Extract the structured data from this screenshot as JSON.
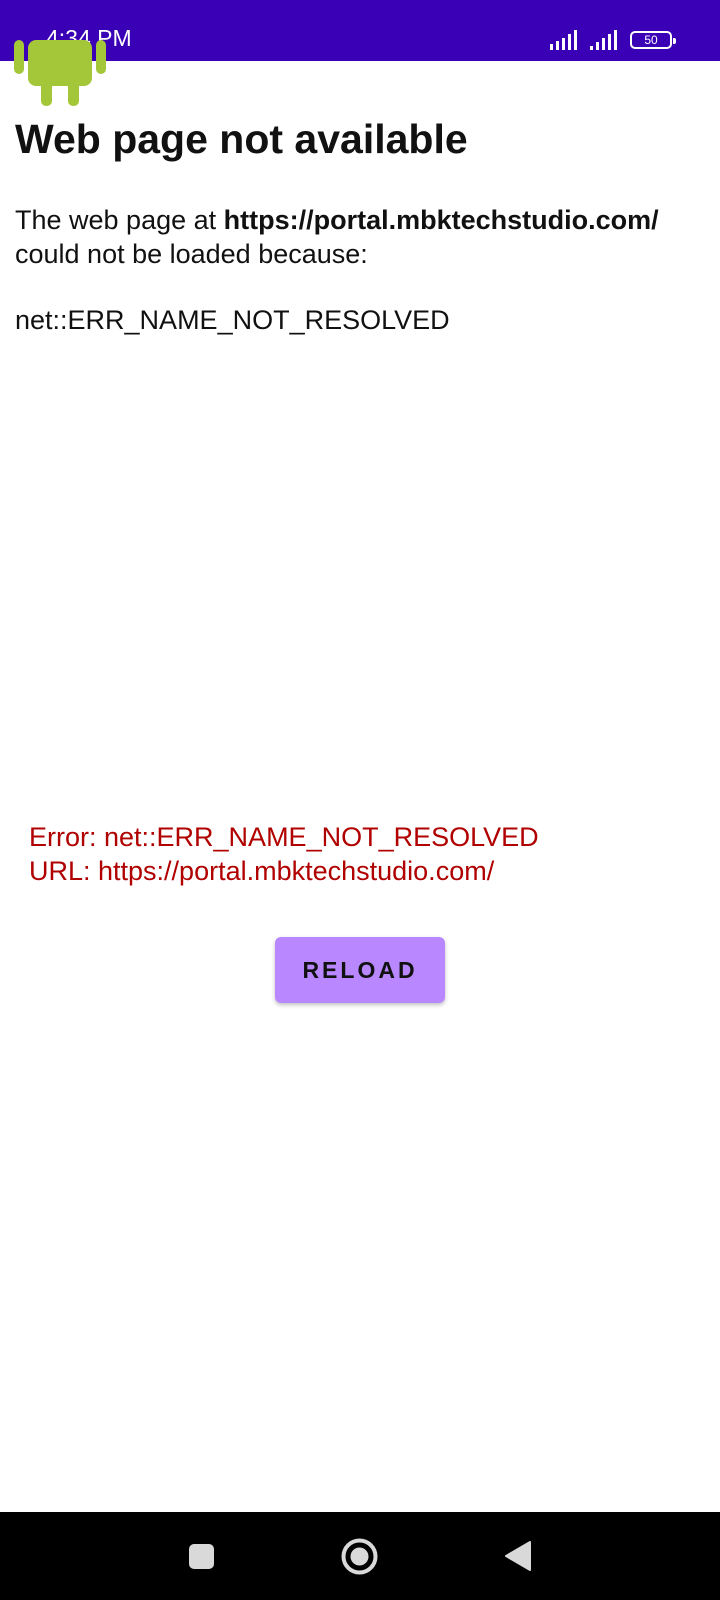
{
  "status_bar": {
    "time": "4:34 PM",
    "battery_level": "50",
    "icons": [
      "signal-icon",
      "signal-icon",
      "battery-icon"
    ],
    "background": "#3a00b6"
  },
  "error_page": {
    "logo_icon": "android-icon",
    "title": "Web page not available",
    "message_prefix": "The web page at ",
    "url": "https://portal.mbktechstudio.com/",
    "message_suffix": "could not be loaded because:",
    "error_code": "net::ERR_NAME_NOT_RESOLVED"
  },
  "app_error": {
    "error_line": "Error: net::ERR_NAME_NOT_RESOLVED",
    "url_line": "URL: https://portal.mbktechstudio.com/",
    "color": "#b00000",
    "reload_label": "RELOAD",
    "reload_color": "#b987ff"
  },
  "nav_bar": {
    "icons": [
      "recents-icon",
      "home-icon",
      "back-icon"
    ]
  }
}
